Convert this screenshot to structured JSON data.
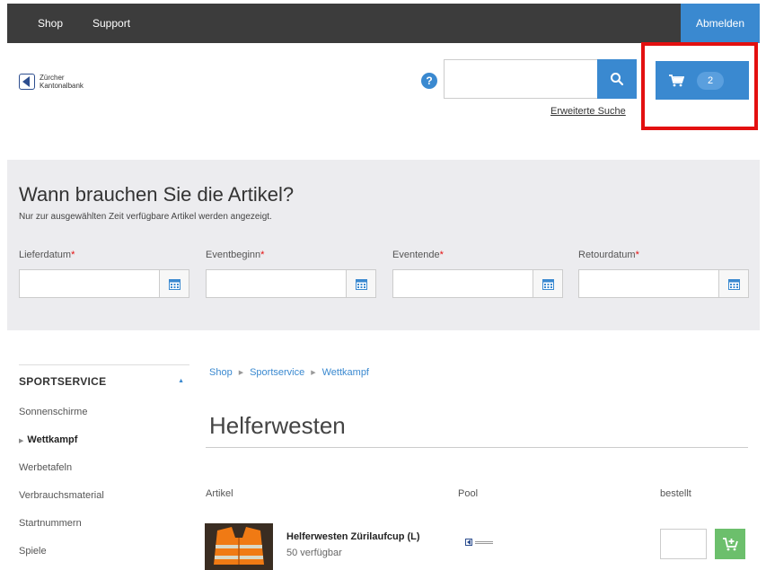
{
  "topbar": {
    "nav": [
      {
        "label": "Shop",
        "name": "nav-shop"
      },
      {
        "label": "Support",
        "name": "nav-support"
      }
    ],
    "logout_label": "Abmelden"
  },
  "header": {
    "logo_line1": "Zürcher",
    "logo_line2": "Kantonalbank",
    "help_label": "?",
    "search_value": "",
    "advanced_search_label": "Erweiterte Suche",
    "cart_count": "2"
  },
  "dates": {
    "title": "Wann brauchen Sie die Artikel?",
    "subtitle": "Nur zur ausgewählten Zeit verfügbare Artikel werden angezeigt.",
    "required_mark": "*",
    "fields": [
      {
        "label": "Lieferdatum",
        "value": ""
      },
      {
        "label": "Eventbeginn",
        "value": ""
      },
      {
        "label": "Eventende",
        "value": ""
      },
      {
        "label": "Retourdatum",
        "value": ""
      }
    ]
  },
  "sidebar": {
    "title": "SPORTSERVICE",
    "items": [
      {
        "label": "Sonnenschirme",
        "active": false
      },
      {
        "label": "Wettkampf",
        "active": true
      },
      {
        "label": "Werbetafeln",
        "active": false
      },
      {
        "label": "Verbrauchsmaterial",
        "active": false
      },
      {
        "label": "Startnummern",
        "active": false
      },
      {
        "label": "Spiele",
        "active": false
      }
    ]
  },
  "main": {
    "breadcrumb": [
      "Shop",
      "Sportservice",
      "Wettkampf"
    ],
    "page_title": "Helferwesten",
    "columns": {
      "artikel": "Artikel",
      "pool": "Pool",
      "bestellt": "bestellt"
    },
    "products": [
      {
        "name": "Helferwesten Zürilaufcup (L)",
        "availability": "50 verfügbar",
        "ordered": ""
      }
    ]
  },
  "colors": {
    "topbar": "#3c3c3c",
    "accent": "#3a89d0",
    "highlight": "#e31010",
    "add_button": "#6cbf6c",
    "panel": "#ececef"
  }
}
